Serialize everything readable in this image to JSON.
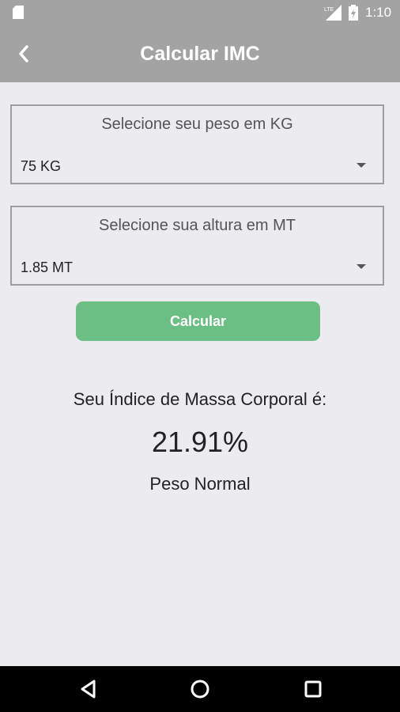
{
  "status_bar": {
    "time": "1:10"
  },
  "app_bar": {
    "title": "Calcular IMC"
  },
  "weight_picker": {
    "label": "Selecione seu peso em KG",
    "value": "75 KG"
  },
  "height_picker": {
    "label": "Selecione sua altura em MT",
    "value": "1.85 MT"
  },
  "calculate_button": {
    "label": "Calcular"
  },
  "result": {
    "label": "Seu Índice de Massa Corporal é:",
    "value": "21.91%",
    "classification": "Peso Normal"
  },
  "colors": {
    "app_bar": "#a3a3a3",
    "background": "#ebebf0",
    "button": "#6bbf84",
    "nav_bar": "#000000"
  }
}
